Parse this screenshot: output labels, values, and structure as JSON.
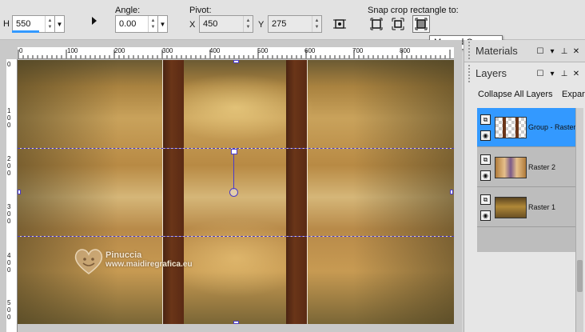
{
  "toolbar": {
    "h_label": "H",
    "h_value": "550",
    "angle_label": "Angle:",
    "angle_value": "0.00",
    "pivot_label": "Pivot:",
    "x_label": "X",
    "x_value": "450",
    "y_label": "Y",
    "y_value": "275",
    "snap_label": "Snap crop rectangle to:"
  },
  "tooltip": "Merged Opaque",
  "ruler_top": [
    "0",
    "100",
    "200",
    "300",
    "400",
    "500",
    "600",
    "700",
    "800"
  ],
  "ruler_left": [
    "0",
    "1\n0\n0",
    "2\n0\n0",
    "3\n0\n0",
    "4\n0\n0",
    "5\n0\n0"
  ],
  "watermark": {
    "name": "Pinuccia",
    "site": "www.maidiregrafica.eu"
  },
  "materials_panel": {
    "title": "Materials"
  },
  "layers_panel": {
    "title": "Layers",
    "collapse_label": "Collapse All Layers",
    "expand_label": "Expar",
    "layers": [
      {
        "name": "Group - Raster",
        "selected": true
      },
      {
        "name": "Raster 2",
        "selected": false
      },
      {
        "name": "Raster 1",
        "selected": false
      }
    ]
  },
  "colors": {
    "selection": "#3399ff",
    "guide": "#4b3cc8"
  }
}
